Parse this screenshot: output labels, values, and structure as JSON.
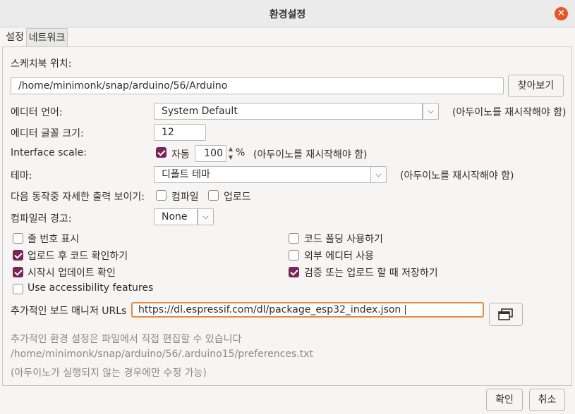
{
  "window": {
    "title": "환경설정",
    "close_icon": "close-icon"
  },
  "tabs": [
    {
      "label": "설정"
    },
    {
      "label": "네트워크"
    }
  ],
  "sketchbook": {
    "label": "스케치북 위치:",
    "path": "/home/minimonk/snap/arduino/56/Arduino",
    "browse_label": "찾아보기"
  },
  "editor_language": {
    "label": "에디터 언어:",
    "value": "System Default",
    "note": "(아두이노를 재시작해야 함)"
  },
  "font_size": {
    "label": "에디터 글꼴 크기:",
    "value": "12"
  },
  "interface_scale": {
    "label": "Interface scale:",
    "auto_label": "자동",
    "value": "100",
    "unit": "%",
    "note": "(아두이노를 재시작해야 함)",
    "auto_checked": true
  },
  "theme": {
    "label": "테마:",
    "value": "디폴트 테마",
    "note": "(아두이노를 재시작해야 함)"
  },
  "verbose": {
    "label": "다음 동작중 자세한 출력 보이기:",
    "compile_label": "컴파일",
    "upload_label": "업로드"
  },
  "compiler_warnings": {
    "label": "컴파일러 경고:",
    "value": "None"
  },
  "options": {
    "line_numbers": "줄 번호 표시",
    "code_folding": "코드 폴딩 사용하기",
    "verify_after_upload": "업로드 후 코드 확인하기",
    "external_editor": "외부 에디터 사용",
    "check_updates": "시작시 업데이트 확인",
    "save_on_verify": "검증 또는 업로드 할 때 저장하기",
    "accessibility": "Use accessibility features"
  },
  "board_urls": {
    "label": "추가적인 보드 매니저 URLs",
    "value": "https://dl.espressif.com/dl/package_esp32_index.json"
  },
  "footer_notes": {
    "line1": "추가적인 환경 설정은 파일에서 직접 편집할 수 있습니다",
    "line2": "/home/minimonk/snap/arduino/56/.arduino15/preferences.txt",
    "line3": "(아두이노가 실행되지 않는 경우에만 수정 가능)"
  },
  "buttons": {
    "ok": "확인",
    "cancel": "취소"
  },
  "colors": {
    "accent": "#7c2457",
    "close": "#e95420",
    "url_border": "#e98a3a"
  }
}
